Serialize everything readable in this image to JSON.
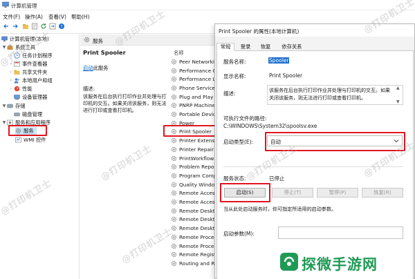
{
  "window": {
    "title": "计算机管理"
  },
  "menu": [
    "文件(F)",
    "操作(A)",
    "查看(V)",
    "帮助(H)"
  ],
  "tree": {
    "root": "计算机管理(本地)",
    "system_tools": "系统工具",
    "task_scheduler": "任务计划程序",
    "event_viewer": "事件查看器",
    "shared_folders": "共享文件夹",
    "local_users": "本地用户和组",
    "performance": "性能",
    "device_manager": "设备管理器",
    "storage": "存储",
    "disk_management": "磁盘管理",
    "services_apps": "服务和应用程序",
    "services": "服务",
    "wmi": "WMI 控件"
  },
  "services_panel": {
    "header": "服务",
    "selected_name": "Print Spooler",
    "start_link": "启动",
    "start_suffix": "此服务",
    "desc_title": "描述:",
    "desc_text": "该服务在后台执行打印作业并处理与打印机的交互。如果关闭该服务，则无法进行打印或查看打印机。",
    "col_name": "名称",
    "rows": [
      "Peer Networking",
      "Performance Counter",
      "Performance Logs",
      "Phone Service",
      "Plug and Play",
      "PNRP Machine",
      "Portable Device",
      "Power",
      "Print Spooler",
      "Printer Extensions",
      "Printer Repair",
      "PrintWorkflow",
      "Problem Reports",
      "Program Compat",
      "Quality Windows",
      "Remote Access",
      "Remote Access",
      "Remote Desktop",
      "Remote Desktop",
      "Remote Desktop",
      "Remote Procedure",
      "Remote Procedure",
      "Remote Registry",
      "Routing and Remote"
    ]
  },
  "dialog": {
    "title": "Print Spooler 的属性(本地计算机)",
    "tabs": [
      "常规",
      "登录",
      "恢复",
      "依存关系"
    ],
    "service_name_label": "服务名称:",
    "service_name_value": "Spooler",
    "display_name_label": "显示名称:",
    "display_name_value": "Print Spooler",
    "desc_label": "描述:",
    "desc_value": "该服务在后台执行打印作业并处理与打印机的交互。如果关闭该服务，则无法进行打印或查看打印机。",
    "path_label": "可执行文件的路径:",
    "path_value": "C:\\WINDOWS\\System32\\spoolsv.exe",
    "startup_label": "启动类型(E):",
    "startup_value": "自动",
    "status_label": "服务状态:",
    "status_value": "已停止",
    "buttons": {
      "start": "启动(S)",
      "stop": "停止(T)",
      "pause": "暂停(P)",
      "resume": "恢复(R)"
    },
    "hint": "当从此处启动服务时，你可指定所适用的启动参数。",
    "params_label": "启动参数(M):"
  },
  "watermarks": [
    "@打印机卫士",
    "@打印机卫士",
    "@打印机卫士",
    "@打印机卫士",
    "@打印机卫士",
    "@打印机卫士",
    "@打印机卫士",
    "@打印机卫士"
  ],
  "brand": {
    "text": "探微手游网",
    "color": "#1f9a55"
  },
  "colors": {
    "highlight": "#e0141e",
    "selection": "#cce4f7",
    "accent": "#0a64c8"
  }
}
